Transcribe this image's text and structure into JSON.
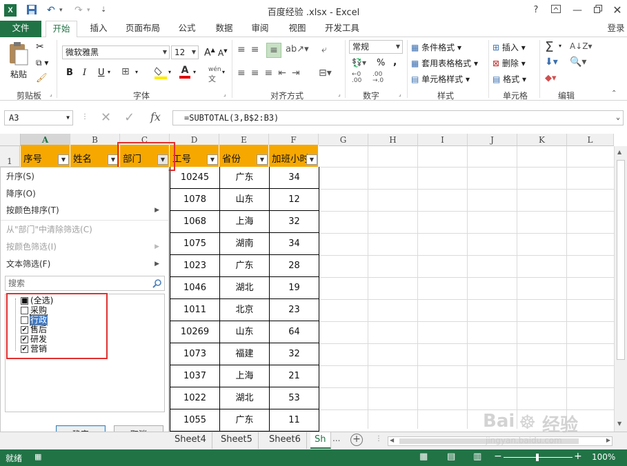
{
  "window": {
    "title": "百度经验 .xlsx - Excel",
    "help": "?",
    "login": "登录"
  },
  "tabs": [
    {
      "label": "文件"
    },
    {
      "label": "开始"
    },
    {
      "label": "插入"
    },
    {
      "label": "页面布局"
    },
    {
      "label": "公式"
    },
    {
      "label": "数据"
    },
    {
      "label": "审阅"
    },
    {
      "label": "视图"
    },
    {
      "label": "开发工具"
    }
  ],
  "ribbon": {
    "clipboard": {
      "paste": "粘贴",
      "label": "剪贴板"
    },
    "font": {
      "name": "微软雅黑",
      "size": "12",
      "label": "字体",
      "bold": "B",
      "italic": "I",
      "underline": "U",
      "phonetic": "wén",
      "font_color_letter": "A"
    },
    "align": {
      "label": "对齐方式"
    },
    "number": {
      "format": "常规",
      "label": "数字",
      "percent": "%",
      "comma": ","
    },
    "styles": {
      "cond": "条件格式",
      "table": "套用表格格式",
      "cell": "单元格样式",
      "label": "样式"
    },
    "cells": {
      "insert": "插入",
      "delete": "删除",
      "format": "格式",
      "label": "单元格"
    },
    "editing": {
      "label": "编辑"
    }
  },
  "formula_bar": {
    "name_box": "A3",
    "fx": "fx",
    "formula": "=SUBTOTAL(3,B$2:B3)"
  },
  "columns": [
    "A",
    "B",
    "C",
    "D",
    "E",
    "F",
    "G",
    "H",
    "I",
    "J",
    "K",
    "L"
  ],
  "row_header_1": "1",
  "header_row": [
    "序号",
    "姓名",
    "部门",
    "工号",
    "省份",
    "加班小时"
  ],
  "rows": [
    {
      "id": "10245",
      "prov": "广东",
      "hours": "34"
    },
    {
      "id": "1078",
      "prov": "山东",
      "hours": "12"
    },
    {
      "id": "1068",
      "prov": "上海",
      "hours": "32"
    },
    {
      "id": "1075",
      "prov": "湖南",
      "hours": "34"
    },
    {
      "id": "1023",
      "prov": "广东",
      "hours": "28"
    },
    {
      "id": "1046",
      "prov": "湖北",
      "hours": "19"
    },
    {
      "id": "1011",
      "prov": "北京",
      "hours": "23"
    },
    {
      "id": "10269",
      "prov": "山东",
      "hours": "64"
    },
    {
      "id": "1073",
      "prov": "福建",
      "hours": "32"
    },
    {
      "id": "1037",
      "prov": "上海",
      "hours": "21"
    },
    {
      "id": "1022",
      "prov": "湖北",
      "hours": "53"
    },
    {
      "id": "1055",
      "prov": "广东",
      "hours": "11"
    }
  ],
  "filter_menu": {
    "sort_asc": "升序(S)",
    "sort_desc": "降序(O)",
    "sort_color": "按颜色排序(T)",
    "clear": "从\"部门\"中清除筛选(C)",
    "filter_color": "按颜色筛选(I)",
    "text_filter": "文本筛选(F)",
    "search_placeholder": "搜索",
    "items": [
      {
        "label": "(全选)",
        "state": "partial"
      },
      {
        "label": "采购",
        "state": "unchecked"
      },
      {
        "label": "行政",
        "state": "unchecked"
      },
      {
        "label": "售后",
        "state": "checked"
      },
      {
        "label": "研发",
        "state": "checked"
      },
      {
        "label": "营销",
        "state": "checked"
      }
    ],
    "ok": "确定",
    "cancel": "取消"
  },
  "sheet_tabs": [
    "Sheet4",
    "Sheet5",
    "Sheet6",
    "Sh"
  ],
  "status": {
    "ready": "就绪",
    "zoom": "100%"
  },
  "watermark": {
    "line1": "Bai",
    "line2": "经验",
    "url": "jingyan.baidu.com"
  },
  "colors": {
    "excel_green": "#217346",
    "header_fill": "#f6a800",
    "highlight_red": "#e03030"
  }
}
